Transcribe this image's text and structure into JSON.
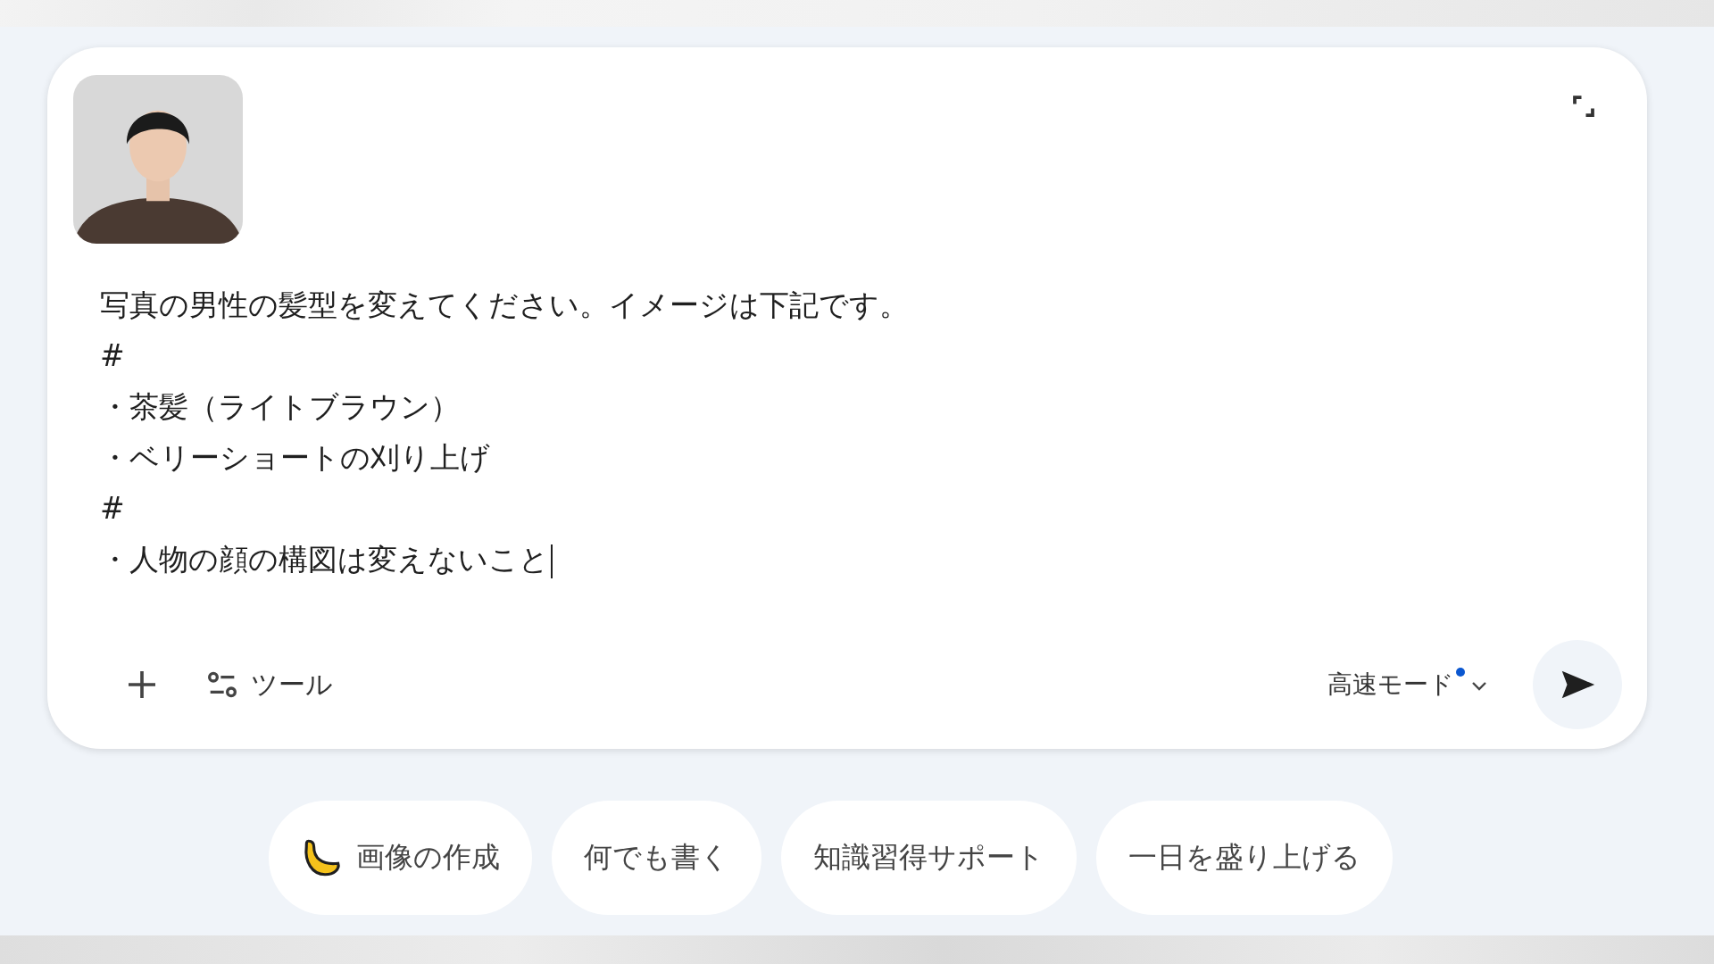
{
  "composer": {
    "prompt": {
      "lines": [
        "写真の男性の髪型を変えてください。イメージは下記です。",
        "#",
        "・茶髪（ライトブラウン）",
        "・ベリーショートの刈り上げ",
        "#",
        "・人物の顔の構図は変えないこと"
      ],
      "focused": true
    },
    "tools_label": "ツール",
    "mode": {
      "label": "高速モード",
      "new_dot": true
    }
  },
  "chips": [
    {
      "label": "画像の作成",
      "kind": "iconed"
    },
    {
      "label": "何でも書く",
      "kind": "plain"
    },
    {
      "label": "知識習得サポート",
      "kind": "plain"
    },
    {
      "label": "一日を盛り上げる",
      "kind": "plain"
    }
  ]
}
